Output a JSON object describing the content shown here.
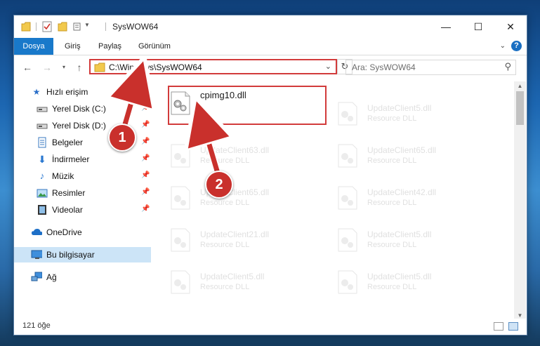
{
  "window": {
    "title": "SysWOW64",
    "controls": {
      "minimize": "—",
      "maximize": "☐",
      "close": "✕"
    }
  },
  "ribbon": {
    "tabs": [
      "Dosya",
      "Giriş",
      "Paylaş",
      "Görünüm"
    ],
    "help": "?"
  },
  "address": {
    "path": "C:\\Windows\\SysWOW64",
    "search_placeholder": "Ara: SysWOW64"
  },
  "sidebar": {
    "items": [
      {
        "label": "Hızlı erişim",
        "icon": "star-icon",
        "pinned": false
      },
      {
        "label": "Yerel Disk (C:)",
        "icon": "drive-icon",
        "pinned": true
      },
      {
        "label": "Yerel Disk (D:)",
        "icon": "drive-icon",
        "pinned": true
      },
      {
        "label": "Belgeler",
        "icon": "documents-icon",
        "pinned": true
      },
      {
        "label": "İndirmeler",
        "icon": "download-icon",
        "pinned": true
      },
      {
        "label": "Müzik",
        "icon": "music-icon",
        "pinned": true
      },
      {
        "label": "Resimler",
        "icon": "pictures-icon",
        "pinned": true
      },
      {
        "label": "Videolar",
        "icon": "video-icon",
        "pinned": true
      },
      {
        "label": "OneDrive",
        "icon": "cloud-icon",
        "pinned": false
      },
      {
        "label": "Bu bilgisayar",
        "icon": "computer-icon",
        "pinned": false
      },
      {
        "label": "Ağ",
        "icon": "network-icon",
        "pinned": false
      }
    ]
  },
  "files": {
    "selected": {
      "name": "cpimg10.dll"
    },
    "left_column": [
      {
        "name": "UpdateClient63.dll",
        "type": "Resource DLL"
      },
      {
        "name": "UpdateClient65.dll",
        "type": "Resource DLL"
      },
      {
        "name": "UpdateClient21.dll",
        "type": "Resource DLL"
      },
      {
        "name": "UpdateClient5.dll",
        "type": "Resource DLL"
      }
    ],
    "right_column": [
      {
        "name": "UpdateClient5.dll",
        "type": "Resource DLL"
      },
      {
        "name": "UpdateClient65.dll",
        "type": "Resource DLL"
      },
      {
        "name": "UpdateClient42.dll",
        "type": "Resource DLL"
      },
      {
        "name": "UpdateClient5.dll",
        "type": "Resource DLL"
      },
      {
        "name": "UpdateClient5.dll",
        "type": "Resource DLL"
      }
    ]
  },
  "status": {
    "count": "121 öğe"
  },
  "callouts": {
    "first": "1",
    "second": "2"
  },
  "colors": {
    "accent": "#1979ca",
    "highlight_red": "#d23b3b",
    "callout_red": "#c9302c",
    "selection": "#cce4f7"
  }
}
